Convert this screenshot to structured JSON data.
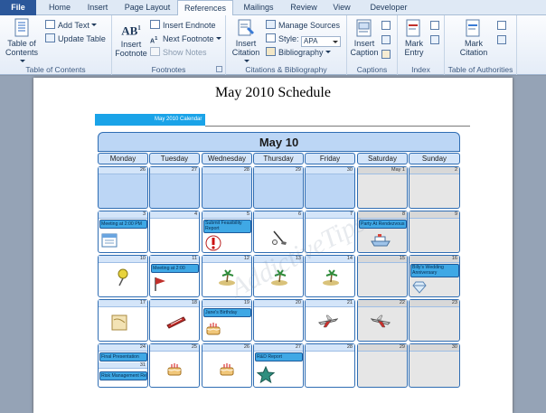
{
  "tabs": {
    "file": "File",
    "home": "Home",
    "insert": "Insert",
    "page_layout": "Page Layout",
    "references": "References",
    "mailings": "Mailings",
    "review": "Review",
    "view": "View",
    "developer": "Developer"
  },
  "ribbon": {
    "toc": {
      "button": "Table of Contents",
      "add_text": "Add Text",
      "update_table": "Update Table",
      "group": "Table of Contents"
    },
    "footnotes": {
      "insert_footnote": "Insert Footnote",
      "insert_endnote": "Insert Endnote",
      "next_footnote": "Next Footnote",
      "show_notes": "Show Notes",
      "ab_glyph": "AB",
      "group": "Footnotes"
    },
    "citations": {
      "insert_citation": "Insert Citation",
      "manage_sources": "Manage Sources",
      "style_label": "Style:",
      "style_value": "APA",
      "bibliography": "Bibliography",
      "group": "Citations & Bibliography"
    },
    "captions": {
      "insert_caption": "Insert Caption",
      "group": "Captions"
    },
    "index": {
      "mark_entry": "Mark Entry",
      "group": "Index"
    },
    "toa": {
      "mark_citation": "Mark Citation",
      "group": "Table of Authorities"
    }
  },
  "document": {
    "title": "May 2010 Schedule",
    "calendar_tab": "May 2010 Calendar",
    "month_header": "May 10",
    "days": [
      "Monday",
      "Tuesday",
      "Wednesday",
      "Thursday",
      "Friday",
      "Saturday",
      "Sunday"
    ],
    "watermark": "AddictiveTips",
    "weeks": [
      [
        "26",
        "27",
        "28",
        "29",
        "30",
        "May 1",
        "2"
      ],
      [
        "3",
        "4",
        "5",
        "6",
        "7",
        "8",
        "9"
      ],
      [
        "10",
        "11",
        "12",
        "13",
        "14",
        "15",
        "16"
      ],
      [
        "17",
        "18",
        "19",
        "20",
        "21",
        "22",
        "23"
      ],
      [
        "24",
        "25",
        "26",
        "27",
        "28",
        "29",
        "30"
      ]
    ],
    "events": {
      "meeting_2pm": "Meeting at 2:00 PM",
      "feasibility_report": "Submit Feasibility Report",
      "party": "Party At Rendezvous",
      "meeting_2pm_tue": "Meeting at 2:00",
      "wedding": "Billy's Wedding Anniversary",
      "birthday": "Jane's Birthday",
      "final_presentation": "Final Presentation",
      "rd_report": "R&D Report",
      "risk_report": "Risk Management Report",
      "extra_day": "31"
    }
  }
}
